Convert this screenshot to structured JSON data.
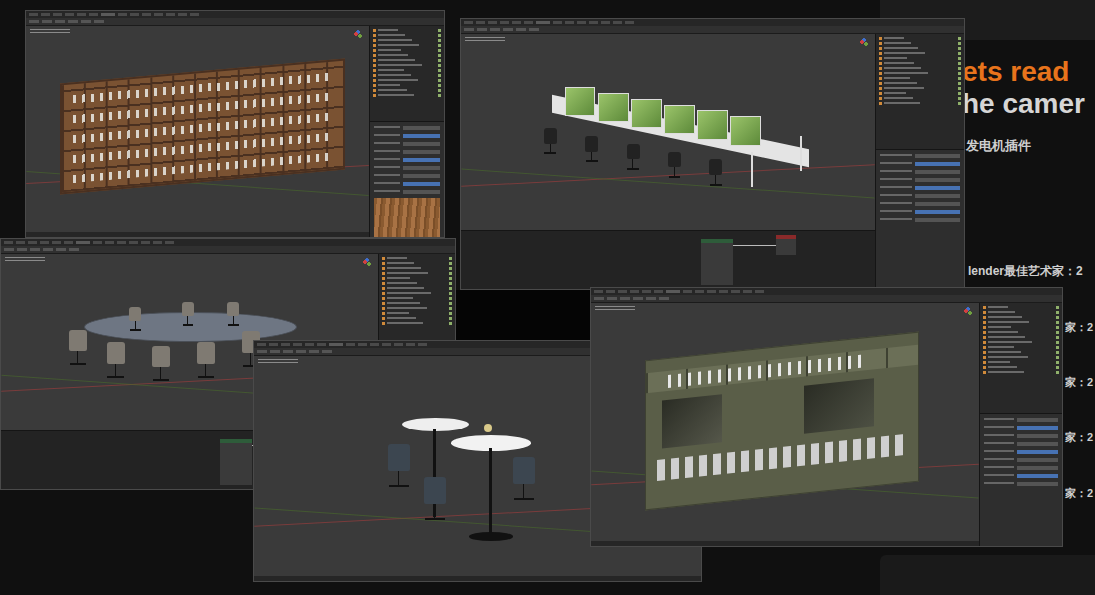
{
  "background": {
    "headline": [
      {
        "text": "ets read",
        "color": "#e8741c"
      },
      {
        "text": "he camer",
        "color": "#d6d6d6"
      }
    ],
    "plugin_note": "发电机插件",
    "artist_lines": [
      "lender最佳艺术家：2",
      "家：2",
      "家：2",
      "家：2",
      "家：2"
    ]
  },
  "windows": [
    {
      "kind": "bookshelf"
    },
    {
      "kind": "desks"
    },
    {
      "kind": "meeting"
    },
    {
      "kind": "bar"
    },
    {
      "kind": "cabinet"
    }
  ]
}
